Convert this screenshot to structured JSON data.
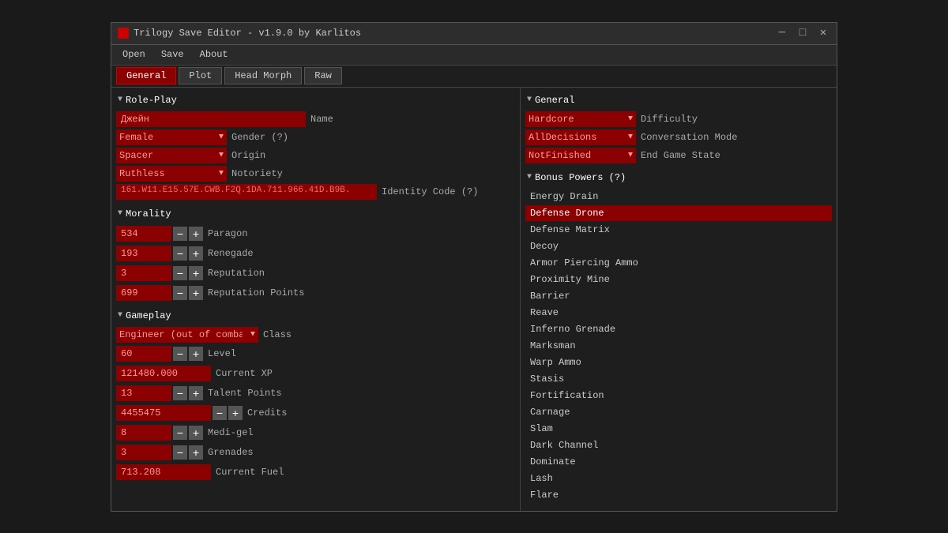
{
  "window": {
    "icon": "■",
    "title": "Trilogy Save Editor - v1.9.0 by Karlitos",
    "controls": {
      "minimize": "─",
      "maximize": "□",
      "close": "✕"
    }
  },
  "menu": {
    "items": [
      "Open",
      "Save",
      "About"
    ]
  },
  "tabs": [
    {
      "label": "General",
      "active": true
    },
    {
      "label": "Plot",
      "active": false
    },
    {
      "label": "Head Morph",
      "active": false
    },
    {
      "label": "Raw",
      "active": false
    }
  ],
  "left": {
    "roleplay": {
      "header": "Role-Play",
      "name_value": "Джейн",
      "name_label": "Name",
      "gender_value": "Female",
      "gender_label": "Gender (?)",
      "origin_value": "Spacer",
      "origin_label": "Origin",
      "notoriety_value": "Ruthless",
      "notoriety_label": "Notoriety",
      "identity_code": "161.W11.E15.57E.CWB.F2Q.1DA.711.966.41D.B9B.",
      "identity_label": "Identity Code (?)"
    },
    "morality": {
      "header": "Morality",
      "paragon_value": "534",
      "paragon_label": "Paragon",
      "renegade_value": "193",
      "renegade_label": "Renegade",
      "reputation_value": "3",
      "reputation_label": "Reputation",
      "rep_points_value": "699",
      "rep_points_label": "Reputation Points"
    },
    "gameplay": {
      "header": "Gameplay",
      "class_value": "Engineer (out of combat)",
      "class_label": "Class",
      "level_value": "60",
      "level_label": "Level",
      "current_xp_value": "121480.000",
      "current_xp_label": "Current XP",
      "talent_value": "13",
      "talent_label": "Talent Points",
      "credits_value": "4455475",
      "credits_label": "Credits",
      "medi_value": "8",
      "medi_label": "Medi-gel",
      "grenades_value": "3",
      "grenades_label": "Grenades",
      "fuel_value": "713.208",
      "fuel_label": "Current Fuel"
    }
  },
  "right": {
    "general": {
      "header": "General",
      "difficulty_value": "Hardcore",
      "difficulty_label": "Difficulty",
      "conversation_value": "AllDecisions",
      "conversation_label": "Conversation Mode",
      "endgame_value": "NotFinished",
      "endgame_label": "End Game State"
    },
    "bonus_powers": {
      "header": "Bonus Powers (?)",
      "items": [
        {
          "name": "Energy Drain",
          "selected": false
        },
        {
          "name": "Defense Drone",
          "selected": true
        },
        {
          "name": "Defense Matrix",
          "selected": false
        },
        {
          "name": "Decoy",
          "selected": false
        },
        {
          "name": "Armor Piercing Ammo",
          "selected": false
        },
        {
          "name": "Proximity Mine",
          "selected": false
        },
        {
          "name": "Barrier",
          "selected": false
        },
        {
          "name": "Reave",
          "selected": false
        },
        {
          "name": "Inferno Grenade",
          "selected": false
        },
        {
          "name": "Marksman",
          "selected": false
        },
        {
          "name": "Warp Ammo",
          "selected": false
        },
        {
          "name": "Stasis",
          "selected": false
        },
        {
          "name": "Fortification",
          "selected": false
        },
        {
          "name": "Carnage",
          "selected": false
        },
        {
          "name": "Slam",
          "selected": false
        },
        {
          "name": "Dark Channel",
          "selected": false
        },
        {
          "name": "Dominate",
          "selected": false
        },
        {
          "name": "Lash",
          "selected": false
        },
        {
          "name": "Flare",
          "selected": false
        }
      ]
    }
  }
}
